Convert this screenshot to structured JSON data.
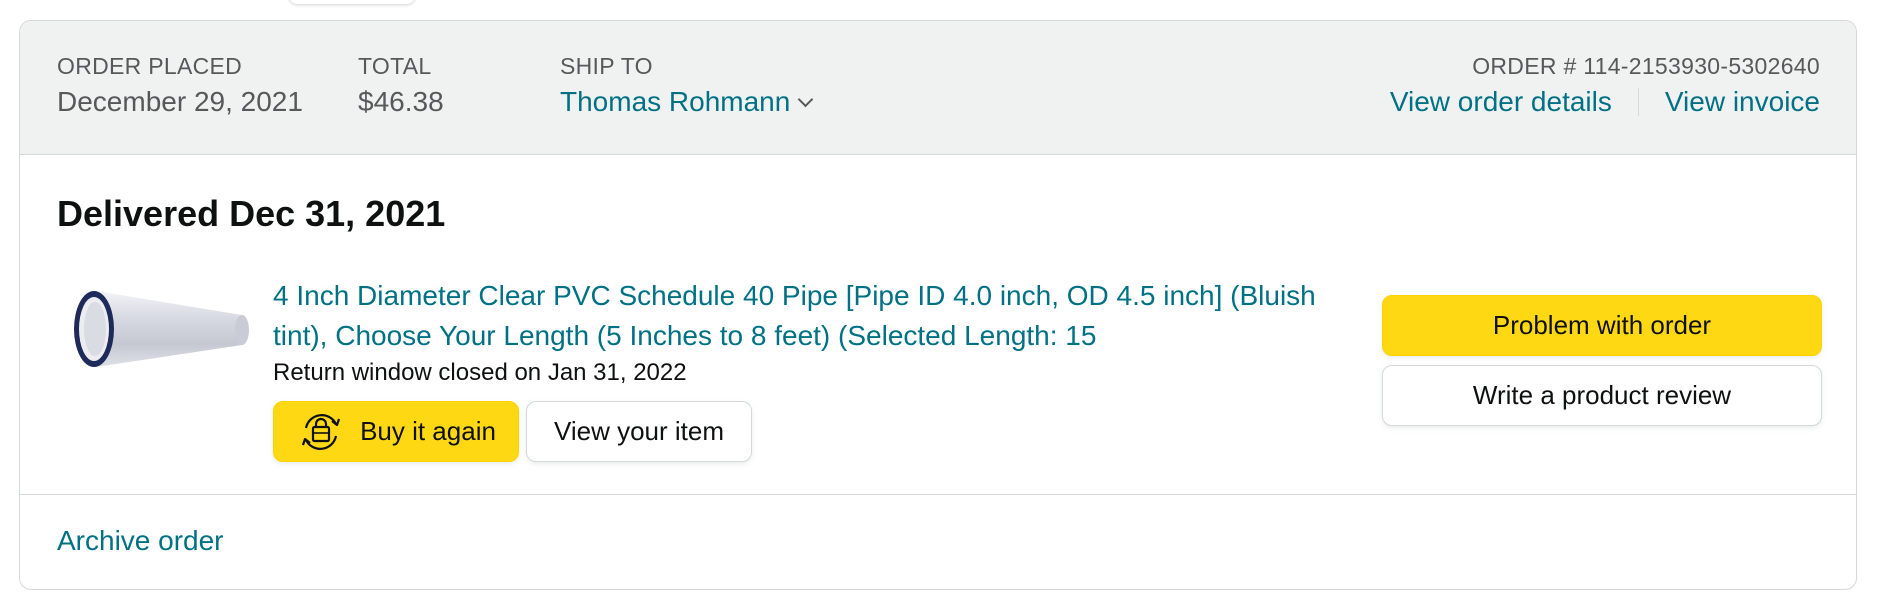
{
  "order": {
    "placed_label": "ORDER PLACED",
    "placed_date": "December 29, 2021",
    "total_label": "TOTAL",
    "total_value": "$46.38",
    "ship_to_label": "SHIP TO",
    "ship_to_name": "Thomas Rohmann",
    "order_number": "ORDER # 114-2153930-5302640",
    "view_details_label": "View order details",
    "view_invoice_label": "View invoice"
  },
  "delivery": {
    "status": "Delivered Dec 31, 2021"
  },
  "item": {
    "image_icon": "clear-pvc-pipe-image",
    "title": "4 Inch Diameter Clear PVC Schedule 40 Pipe [Pipe ID 4.0 inch, OD 4.5 inch] (Bluish tint), Choose Your Length (5 Inches to 8 feet) (Selected Length: 15",
    "return_note": "Return window closed on Jan 31, 2022",
    "buy_again_label": "Buy it again",
    "buy_again_icon": "buy-again-icon",
    "view_item_label": "View your item"
  },
  "actions": {
    "problem_label": "Problem with order",
    "review_label": "Write a product review"
  },
  "footer": {
    "archive_label": "Archive order"
  },
  "colors": {
    "link": "#007185",
    "header_bg": "#f0f2f2",
    "button_yellow": "#ffd814",
    "border": "#d5d9d9"
  }
}
